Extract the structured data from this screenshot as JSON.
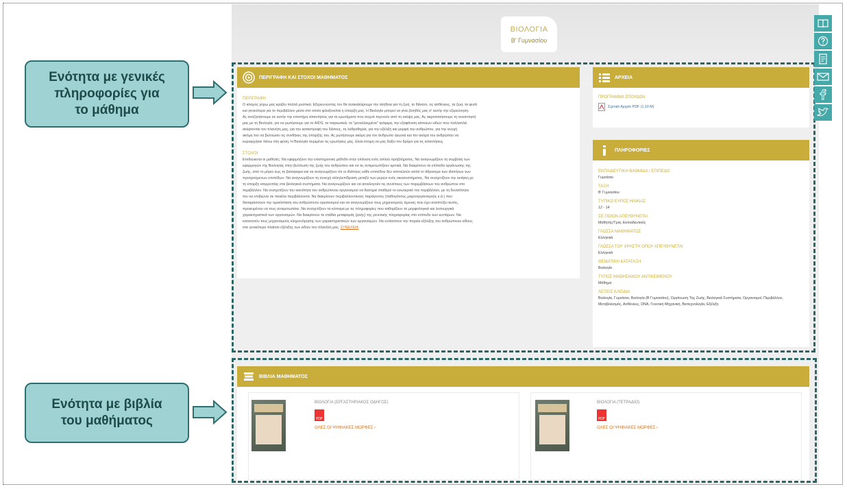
{
  "page": {
    "title": "ΒΙΟΛΟΓΙΑ",
    "subtitle": "Β' Γυμνασίου"
  },
  "callouts": {
    "general_info": [
      "Ενότητα με γενικές",
      "πληροφορίες για",
      "το μάθημα"
    ],
    "books": [
      "Ενότητα με βιβλία",
      "του μαθήματος"
    ]
  },
  "description": {
    "header": "ΠΕΡΙΓΡΑΦΗ ΚΑΙ ΣΤΟΧΟΙ ΜΑΘΗΜΑΤΟΣ",
    "desc_label": "ΠΕΡΙΓΡΑΦΗ",
    "desc_lines": [
      "Ο κόσμος γύρω μας κρύβει πολλά μυστικά. Εξερευνώντας τον θα ανακαλύψουμε την αλήθεια για τη ζωή, το θάνατο, τις ασθένειες, τα ζώα, τα φυτά",
      "και γενικότερα για το περιβάλλον μέσα στο οποίο φιλοξενείται η ύπαρξή μας. Η Βιολογία μπορεί να γίνει βοηθός μας σ' αυτήν την εξερεύνηση.",
      "Ας αναζητήσουμε σε αυτήν την επιστήμη απαντήσεις για τα ερωτήματα που συχνά περνούν από τη σκέψη μας. Ας ακροπατήσουμε τη συναντησή",
      "μας με τη Βιολογία, για να ρωτήσουμε για το AIDS, τα παρκωτικά, τα \"μεταλλαγμένα\" τρόφιμα, την εξαφάνιση κάποιων ειδών που πολλαπλά",
      "σκέφτονται τον πλανήτη μας, για την καταστροφή του δάσους, τη λαθροθηρία, για την εξέλιξη και μορφή του ανθρώπου, για την ανυχή",
      "ακόμη του να βελτιώσει τις συνθήκες της ύπαρξής του. Ας ρωτήσουμε ακόμη για τον άνθρωπο αγωνιά και τον ακόμα του ανθρώπου να",
      "κυριαρχήσει πάνω στη φύση. Η Βιολογία περιμένει τις ερωτήσεις μας. Είναι έτοιμη να μας δείξει τον δρόμο για τις απαντήσεις."
    ],
    "goals_label": "ΣΤΟΧΟΙ",
    "goals_lines": [
      "Επιδιώκεται οι μαθητές: Να εφαρμόζουν την επιστημονική μέθοδο στην επίλυση ενός απλού προβλήματος. Να αναγνωρίζουν τη συμβολή των",
      "εφαρμογών της Βιολογίας στην βελτίωση της ζωής του ανθρώπου και να τις αντιμετωπίζουν κριτικά. Να διακρίνουν τα επίπεδα οργάνωσης της",
      "ζωής, από το μόριο έως τη βιόσφαιρα και να αναγνωρίζουν ότι οι ιδιότητες κάθε επιπέδου δεν αποτελούν απλά το άθροισμα των ιδιοτήτων των",
      "προηγούμενων επιπέδων. Να αναγνωρίζουν τη συνεχή αλληλεπίδραση μεταξύ των μερών ενός οικοσυστήματος. Να συσχετίζουν την ανάγκη με",
      "τη ύπαρξη ισορροπίας στα βιολογικά συστήματα. Να αναγνωρίζουν και να αιτιολογούν τις συνέπειες των παρεμβάσεων του ανθρώπου στο",
      "περιβάλλον. Να συσχετίζουν την ικανότητα του ανθρώπινου οργανισμού να διατηρεί σταθερό το εσωτερικό του περιβάλλον, με τη δυνατότητα",
      "του να επιβιώνει σε ποικίλα περιβάλλοντα. Να διακρίνουν περιβαλλοντικούς παράγοντες (παθογόνους μικροοργανισμούς κ.ά.) που",
      "διαταράσσουν την ομοιόσταση του ανθρώπινου οργανισμού και να αναγνωρίζουν τους μηχανισμούς άμυνας που έχει αναπτύξει αυτός,",
      "προκειμένου να τους αντιμετωπίσει. Να συσχετίζουν τα κύτταρα με τις πληροφορίες που καθορίζουν τα μορφολογικά και λειτουργικά",
      "χαρακτηριστικά των οργανισμών. Να διακρίνουν τα στάδια μεταφοράς (ροής) της γενετικής πληροφορίας στο επίπεδο των κυττάρων. Να",
      "κατανοούν τους μηχανισμούς κληρονόμησης των χαρακτηριστικών των οργανισμών. Να εντάσσουν την πορεία εξέλιξης του ανθρώπινου είδους",
      "στο γενικότερο πλαίσιο εξέλιξης των ειδών του πλανήτη μας."
    ],
    "more_link": "ΣΥΝΕΧΕΙΑ"
  },
  "files": {
    "header": "ΑΡΧΕΙΑ",
    "label": "ΠΡΟΓΡΑΜΜΑ ΣΠΟΥΔΩΝ",
    "link": "Σχετικό Αρχείο PDF (1,10 M)"
  },
  "info": {
    "header": "ΠΛΗΡΟΦΟΡΙΕΣ",
    "fields": [
      {
        "label": "ΕΚΠΑΙΔΕΥΤΙΚΗ ΒΑΘΜΙΔΑ / ΕΠΙΠΕΔΟ",
        "value": "Γυμνάσιο"
      },
      {
        "label": "ΤΑΞΗ",
        "value": "Β' Γυμνασίου"
      },
      {
        "label": "ΤΥΠΙΚΟ ΕΥΡΟΣ ΗΛΙΚΙΑΣ",
        "value": "12 - 14"
      },
      {
        "label": "ΣΕ ΠΟΙΟΝ ΑΠΕΥΘΥΝΕΤΑΙ",
        "value": "Μαθητής/Τρια, Εκπαιδευτικός"
      },
      {
        "label": "ΓΛΩΣΣΑ ΜΑΘΗΜΑΤΟΣ",
        "value": "Ελληνικά"
      },
      {
        "label": "ΓΛΩΣΣΑ ΤΟΥ ΧΡΗΣΤΗ ΟΠΟΥ ΑΠΕΥΘΥΝΕΤΑΙ",
        "value": "Ελληνικά"
      },
      {
        "label": "ΘΕΜΑΤΙΚΗ ΚΑΤΑΤΑΞΗ",
        "value": "Βιολογία"
      },
      {
        "label": "ΤΥΠΟΣ ΜΑΘΗΣΙΑΚΟΥ ΑΝΤΙΚΕΙΜΕΝΟΥ",
        "value": "Μάθημα"
      },
      {
        "label": "ΛΕΞΕΙΣ ΚΛΕΙΔΙΑ",
        "value": "Βιολογία, Γυμνάσιο, Βιολογία (Β Γυμνασίου), Οργάνωση Της Ζωής, Βιολογικά Συστήματα, Οργανισμοί, Περιβάλλον, Μεταβολισμός, Ασθένειες, DNA, Γενετική Μηχανική, Βιοτεχνολογία, Εξέλιξη"
      }
    ]
  },
  "books": {
    "header": "ΒΙΒΛΙΑ ΜΑΘΗΜΑΤΟΣ",
    "items": [
      {
        "title": "ΒΙΟΛΟΓΙΑ (ΕΡΓΑΣΤΗΡΙΑΚΟΣ ΟΔΗΓΟΣ)",
        "link": "ΟΛΕΣ ΟΙ ΨΗΦΙΑΚΕΣ ΜΟΡΦΕΣ"
      },
      {
        "title": "ΒΙΟΛΟΓΙΑ (ΤΕΤΡΑΔΙΟ)",
        "link": "ΟΛΕΣ ΟΙ ΨΗΦΙΑΚΕΣ ΜΟΡΦΕΣ"
      }
    ]
  },
  "pdf_badge": "PDF",
  "colors": {
    "accent": "#c9ad3b",
    "callout": "#9fd2d3",
    "dash": "#2b6667",
    "social": "#46a9a9"
  },
  "side_icons": [
    "book-icon",
    "help-icon",
    "document-icon",
    "mail-icon",
    "facebook-icon",
    "twitter-icon"
  ]
}
